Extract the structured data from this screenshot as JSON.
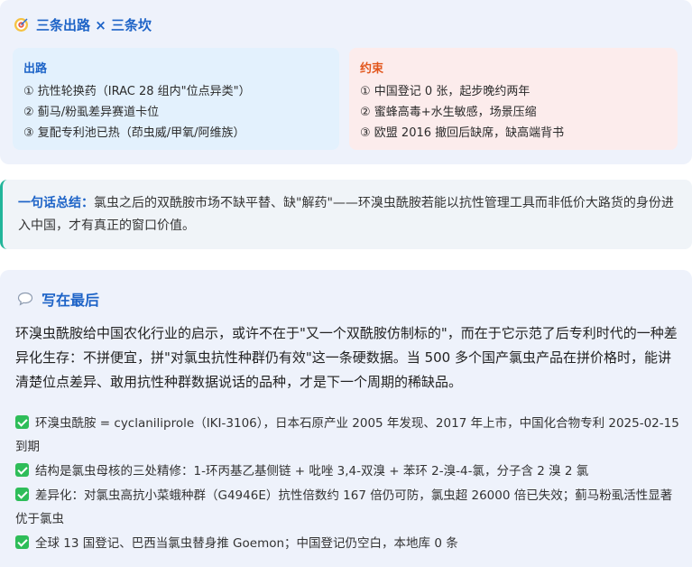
{
  "top": {
    "icon": "target-icon",
    "title": "三条出路 × 三条坎",
    "exit": {
      "title": "出路",
      "items": [
        "① 抗性轮换药（IRAC 28 组内\"位点异类\"）",
        "② 蓟马/粉虱差异赛道卡位",
        "③ 复配专利池已热（茚虫威/甲氧/阿维族）"
      ]
    },
    "limit": {
      "title": "约束",
      "items": [
        "① 中国登记 0 张，起步晚约两年",
        "② 蜜蜂高毒+水生敏感，场景压缩",
        "③ 欧盟 2016 撤回后缺席，缺高端背书"
      ]
    }
  },
  "summary": {
    "label": "一句话总结：",
    "text": "氯虫之后的双酰胺市场不缺平替、缺\"解药\"——环溴虫酰胺若能以抗性管理工具而非低价大路货的身份进入中国，才有真正的窗口价值。"
  },
  "closing": {
    "icon": "speech-bubble-icon",
    "title": "写在最后",
    "intro": "环溴虫酰胺给中国农化行业的启示，或许不在于\"又一个双酰胺仿制标的\"，而在于它示范了后专利时代的一种差异化生存：不拼便宜，拼\"对氯虫抗性种群仍有效\"这一条硬数据。当 500 多个国产氯虫产品在拼价格时，能讲清楚位点差异、敢用抗性种群数据说话的品种，才是下一个周期的稀缺品。",
    "checks": [
      "环溴虫酰胺 = cyclaniliprole（IKI-3106），日本石原产业 2005 年发现、2017 年上市，中国化合物专利 2025-02-15 到期",
      "结构是氯虫母核的三处精修：1-环丙基乙基侧链 + 吡唑 3,4-双溴 + 苯环 2-溴-4-氯，分子含 2 溴 2 氯",
      "差异化：对氯虫高抗小菜蛾种群（G4946E）抗性倍数约 167 倍仍可防，氯虫超 26000 倍已失效；蓟马粉虱活性显著优于氯虫",
      "全球 13 国登记、巴西当氯虫替身推 Goemon；中国登记仍空白，本地库 0 条"
    ]
  }
}
